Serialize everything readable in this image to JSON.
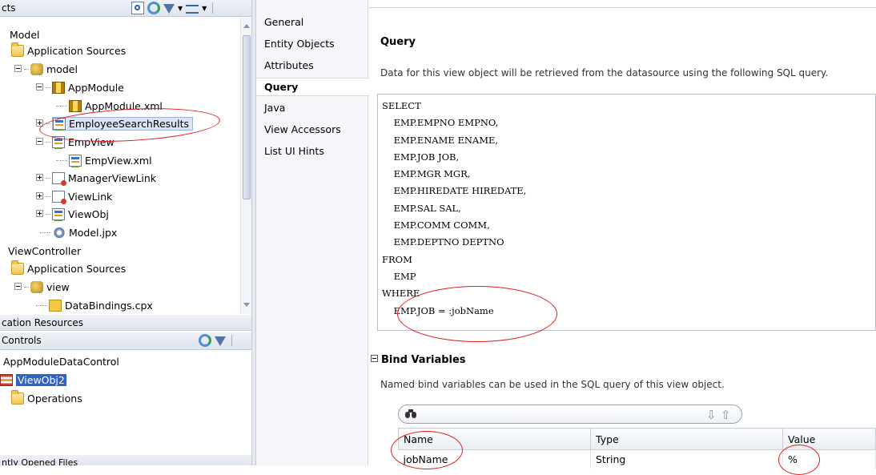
{
  "left_panel": {
    "projects_header": "cts",
    "tree": [
      {
        "label": "Model"
      },
      {
        "label": "Application Sources"
      },
      {
        "label": "model"
      },
      {
        "label": "AppModule"
      },
      {
        "label": "AppModule.xml"
      },
      {
        "label": "EmployeeSearchResults"
      },
      {
        "label": "EmpView"
      },
      {
        "label": "EmpView.xml"
      },
      {
        "label": "ManagerViewLink"
      },
      {
        "label": "ViewLink"
      },
      {
        "label": "ViewObj"
      },
      {
        "label": "Model.jpx"
      },
      {
        "label": "ViewController"
      },
      {
        "label": "Application Sources"
      },
      {
        "label": "view"
      },
      {
        "label": "DataBindings.cpx"
      }
    ],
    "app_resources_header": "cation Resources",
    "data_controls_header": "Controls",
    "data_controls": [
      {
        "label": "AppModuleDataControl"
      },
      {
        "label": "ViewObj2"
      },
      {
        "label": "Operations"
      }
    ],
    "recent_files_header": "ntly Opened Files"
  },
  "nav": {
    "items": [
      {
        "label": "General"
      },
      {
        "label": "Entity Objects"
      },
      {
        "label": "Attributes"
      },
      {
        "label": "Query"
      },
      {
        "label": "Java"
      },
      {
        "label": "View Accessors"
      },
      {
        "label": "List UI Hints"
      }
    ]
  },
  "query": {
    "title": "Query",
    "description": "Data for this view object will be retrieved from the datasource using the following SQL query.",
    "sql": "SELECT\n    EMP.EMPNO EMPNO,\n    EMP.ENAME ENAME,\n    EMP.JOB JOB,\n    EMP.MGR MGR,\n    EMP.HIREDATE HIREDATE,\n    EMP.SAL SAL,\n    EMP.COMM COMM,\n    EMP.DEPTNO DEPTNO\nFROM\n    EMP\nWHERE\n    EMP.JOB = :jobName"
  },
  "bind_variables": {
    "title": "Bind Variables",
    "description": "Named bind variables can be used in the SQL query of this view object.",
    "columns": [
      "Name",
      "Type",
      "Value"
    ],
    "rows": [
      {
        "name": "jobName",
        "type": "String",
        "value": "%"
      }
    ]
  },
  "colors": {
    "annotation": "#e21b1b",
    "selection": "#3163c5"
  }
}
